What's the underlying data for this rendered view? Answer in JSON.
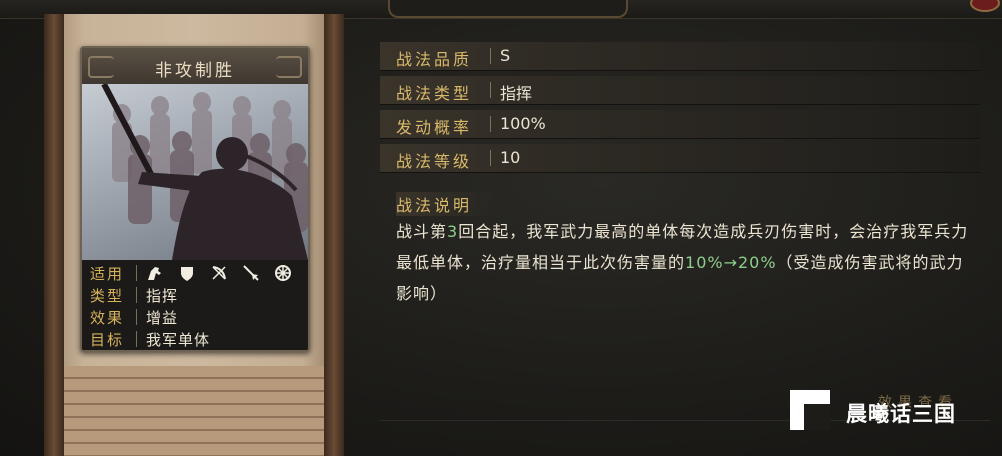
{
  "card": {
    "title": "非攻制胜",
    "info": [
      {
        "key": "适用",
        "icons": [
          "cavalry-icon",
          "shield-icon",
          "bow-icon",
          "spear-icon",
          "wheel-icon"
        ]
      },
      {
        "key": "类型",
        "value": "指挥"
      },
      {
        "key": "效果",
        "value": "增益"
      },
      {
        "key": "目标",
        "value": "我军单体"
      }
    ]
  },
  "stats": [
    {
      "key": "战法品质",
      "value": "S"
    },
    {
      "key": "战法类型",
      "value": "指挥"
    },
    {
      "key": "发动概率",
      "value": "100%"
    },
    {
      "key": "战法等级",
      "value": "10"
    }
  ],
  "description": {
    "label": "战法说明",
    "part1": "战斗第",
    "num1": "3",
    "part2": "回合起，我军武力最高的单体每次造成兵刃伤害时，会治疗我军兵力最低单体，治疗量相当于此次伤害量的",
    "num2": "10%→20%",
    "part3": "（受造成伤害武将的武力影响）"
  },
  "watermark": {
    "text": "晨曦话三国",
    "back_text": "效果查看"
  },
  "colors": {
    "accent_gold": "#d9b96a",
    "value_green": "#8fcf8c"
  }
}
